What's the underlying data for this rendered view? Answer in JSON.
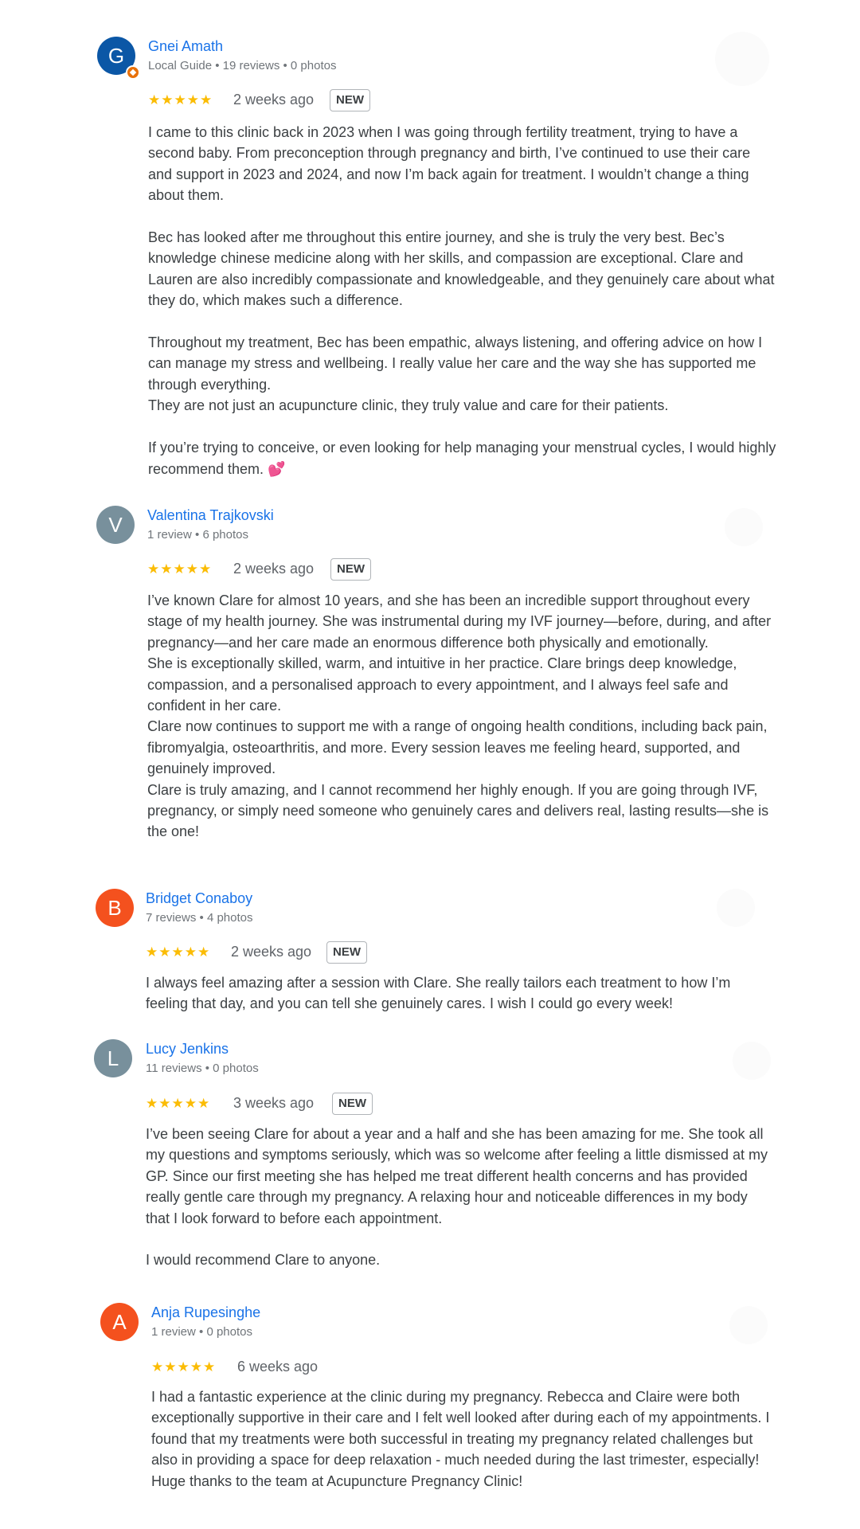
{
  "colors": {
    "link": "#1a73e8",
    "star": "#fbbc04",
    "avatar_blue": "#0b57a6",
    "avatar_gray": "#78909c",
    "avatar_orange": "#f4511e",
    "guide_badge": "#e8710a"
  },
  "reviews": [
    {
      "name": "Gnei Amath",
      "initial": "G",
      "meta": "Local Guide • 19 reviews • 0 photos",
      "stars": "★★★★★",
      "rating": 5,
      "when": "2 weeks ago",
      "badge": "NEW",
      "text": "I came to this clinic back in 2023 when I was going through fertility treatment, trying to have a second baby. From preconception through pregnancy and birth, I’ve continued to use their care and support in 2023 and 2024, and now I’m back again for treatment. I wouldn’t change a thing about them.\n\nBec has looked after me throughout this entire journey, and she is truly the very best. Bec’s knowledge chinese medicine along with her skills, and compassion are exceptional. Clare and Lauren are also incredibly compassionate and knowledgeable, and they genuinely care about what they do, which makes such a difference.\n\nThroughout my treatment, Bec has been empathic, always listening, and offering advice on how I can manage my stress and wellbeing. I really value her care and the way she has supported me through everything.\nThey are not just an acupuncture clinic, they truly value and care for their patients.\n\nIf you’re trying to conceive, or even looking for help managing your menstrual cycles, I would highly recommend them. 💕"
    },
    {
      "name": "Valentina Trajkovski",
      "initial": "V",
      "meta": "1 review • 6 photos",
      "stars": "★★★★★",
      "rating": 5,
      "when": "2 weeks ago",
      "badge": "NEW",
      "text": "I’ve known Clare for almost 10 years, and she has been an incredible support throughout every stage of my health journey. She was instrumental during my IVF journey—before, during, and after pregnancy—and her care made an enormous difference both physically and emotionally.\nShe is exceptionally skilled, warm, and intuitive in her practice. Clare brings deep knowledge, compassion, and a personalised approach to every appointment, and I always feel safe and confident in her care.\nClare now continues to support me with a range of ongoing health conditions, including back pain, fibromyalgia, osteoarthritis, and more. Every session leaves me feeling heard, supported, and genuinely improved.\nClare is truly amazing, and I cannot recommend her highly enough. If you are going through IVF, pregnancy, or simply need someone who genuinely cares and delivers real, lasting results—she is the one!"
    },
    {
      "name": "Bridget Conaboy",
      "initial": "B",
      "meta": "7 reviews • 4 photos",
      "stars": "★★★★★",
      "rating": 5,
      "when": "2 weeks ago",
      "badge": "NEW",
      "text": "I always feel amazing after a session with Clare. She really tailors each treatment to how I’m feeling that day, and you can tell she genuinely cares. I wish I could go every week!"
    },
    {
      "name": "Lucy Jenkins",
      "initial": "L",
      "meta": "11 reviews • 0 photos",
      "stars": "★★★★★",
      "rating": 5,
      "when": "3 weeks ago",
      "badge": "NEW",
      "text": "I’ve been seeing Clare for about a year and a half and she has been amazing for me. She took all my questions and symptoms seriously, which was so welcome after feeling a little dismissed at my GP. Since our first meeting she has helped me treat different health concerns and has provided really gentle care through my pregnancy. A relaxing hour and noticeable differences in my body that I look forward to before each appointment.\n\nI would recommend Clare to anyone."
    },
    {
      "name": "Anja Rupesinghe",
      "initial": "A",
      "meta": "1 review • 0 photos",
      "stars": "★★★★★",
      "rating": 5,
      "when": "6 weeks ago",
      "text": "I had a fantastic experience at the clinic during my pregnancy. Rebecca and Claire were both exceptionally supportive in their care and I felt well looked after during each of my appointments. I found that my treatments were both successful in treating my pregnancy related challenges but also in providing a space for deep relaxation - much needed during the last trimester, especially! Huge thanks to the team at Acupuncture Pregnancy Clinic!"
    }
  ]
}
